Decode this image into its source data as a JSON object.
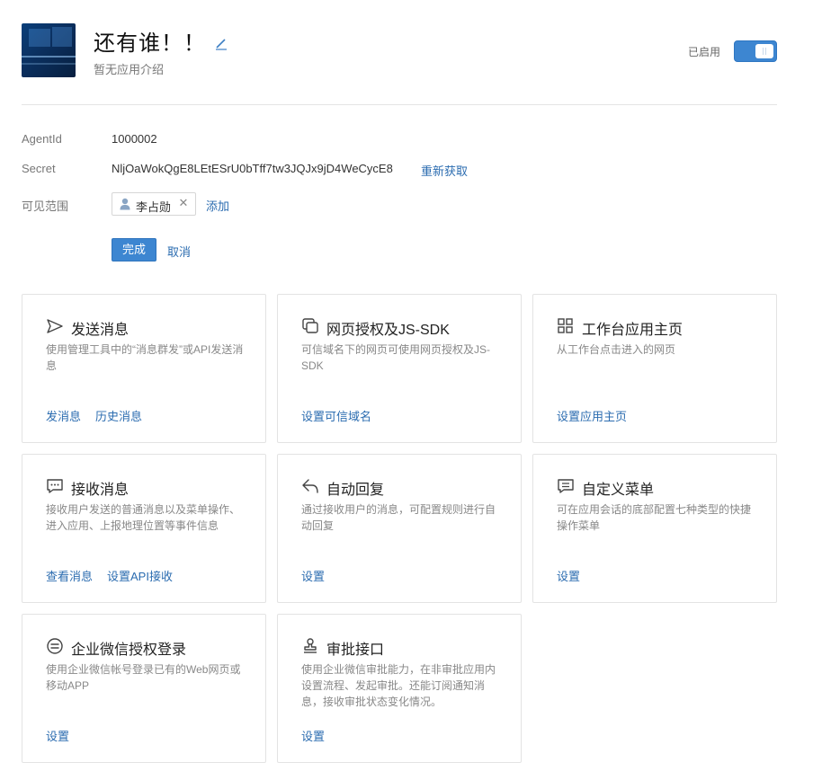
{
  "app": {
    "title": "还有谁！！",
    "description": "暂无应用介绍",
    "status_label": "已启用"
  },
  "info": {
    "agentid_label": "AgentId",
    "agentid_value": "1000002",
    "secret_label": "Secret",
    "secret_value": "NljOaWokQgE8LEtESrU0bTff7tw3JQJx9jD4WeCycE8",
    "regen_label": "重新获取",
    "scope_label": "可见范围",
    "scope_member": "李占勋",
    "add_label": "添加",
    "done_label": "完成",
    "cancel_label": "取消"
  },
  "cards": [
    {
      "icon": "send-icon",
      "title": "发送消息",
      "desc": "使用管理工具中的“消息群发”或API发送消息",
      "links": [
        "发消息",
        "历史消息"
      ]
    },
    {
      "icon": "webpage-auth-icon",
      "title": "网页授权及JS-SDK",
      "desc": "可信域名下的网页可使用网页授权及JS-SDK",
      "links": [
        "设置可信域名"
      ]
    },
    {
      "icon": "grid-icon",
      "title": "工作台应用主页",
      "desc": "从工作台点击进入的网页",
      "links": [
        "设置应用主页"
      ]
    },
    {
      "icon": "chat-icon",
      "title": "接收消息",
      "desc": "接收用户发送的普通消息以及菜单操作、进入应用、上报地理位置等事件信息",
      "links": [
        "查看消息",
        "设置API接收"
      ]
    },
    {
      "icon": "reply-icon",
      "title": "自动回复",
      "desc": "通过接收用户的消息，可配置规则进行自动回复",
      "links": [
        "设置"
      ]
    },
    {
      "icon": "menu-icon",
      "title": "自定义菜单",
      "desc": "可在应用会话的底部配置七种类型的快捷操作菜单",
      "links": [
        "设置"
      ]
    },
    {
      "icon": "wechat-login-icon",
      "title": "企业微信授权登录",
      "desc": "使用企业微信帐号登录已有的Web网页或移动APP",
      "links": [
        "设置"
      ]
    },
    {
      "icon": "approval-stamp-icon",
      "title": "审批接口",
      "desc": "使用企业微信审批能力，在非审批应用内设置流程、发起审批。还能订阅通知消息，接收审批状态变化情况。",
      "links": [
        "设置"
      ]
    }
  ]
}
